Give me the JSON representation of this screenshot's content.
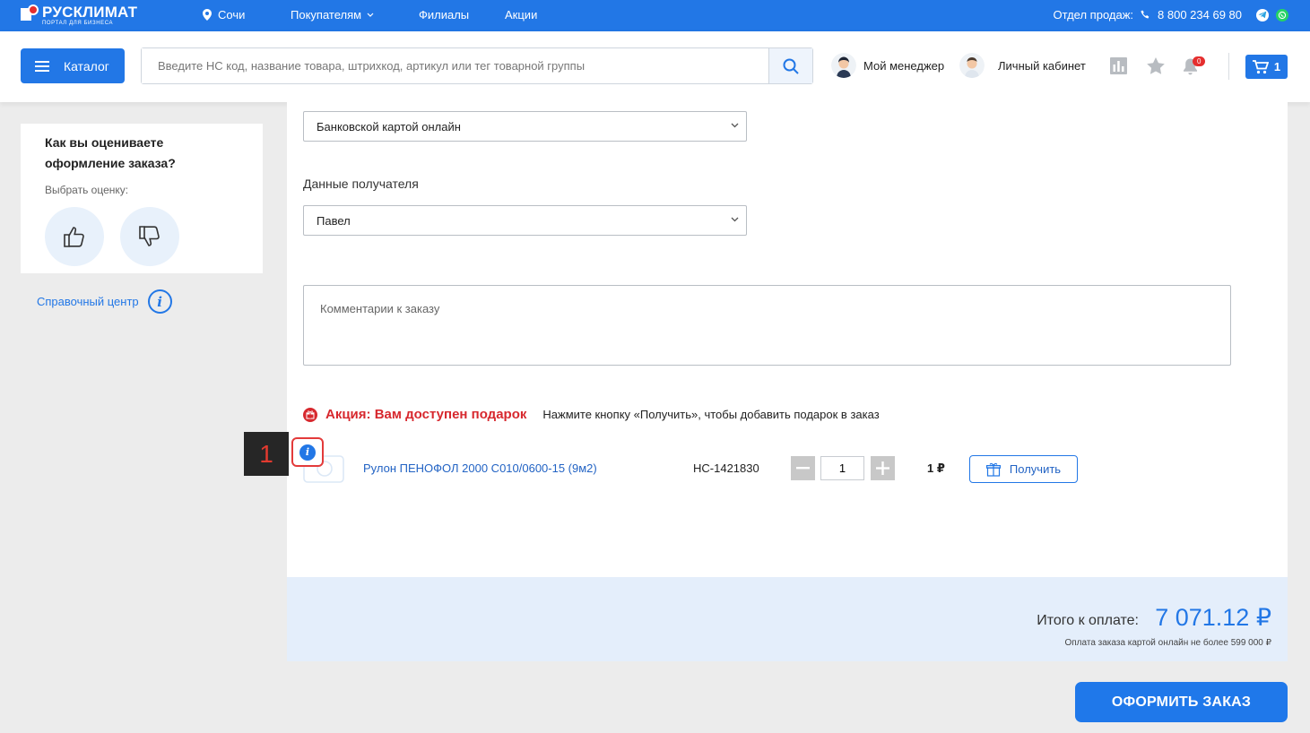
{
  "topbar": {
    "logo_title": "РУСКЛИМАТ",
    "logo_sub": "ПОРТАЛ ДЛЯ БИЗНЕСА",
    "city": "Сочи",
    "nav": [
      "Покупателям",
      "Филиалы",
      "Акции"
    ],
    "sales_label": "Отдел продаж:",
    "phone": "8 800 234 69 80",
    "colors": {
      "brand_blue": "#2277e6",
      "telegram": "#2aa3e0",
      "whatsapp": "#25d366"
    }
  },
  "header": {
    "catalog_label": "Каталог",
    "search_placeholder": "Введите НС код, название товара, штрихкод, артикул или тег товарной группы",
    "manager_label": "Мой менеджер",
    "account_label": "Личный кабинет",
    "notifications_count": "0",
    "cart_count": "1",
    "icons": [
      "menu-icon",
      "search-icon",
      "chart-icon",
      "star-icon",
      "bell-icon",
      "cart-icon"
    ]
  },
  "rating": {
    "title": "Как вы оцениваете оформление заказа?",
    "subtitle": "Выбрать оценку:"
  },
  "help": {
    "label": "Справочный центр"
  },
  "form": {
    "payment_method": "Банковской картой онлайн",
    "recipient_label": "Данные получателя",
    "recipient_value": "Павел",
    "comment_placeholder": "Комментарии к заказу"
  },
  "promo": {
    "title": "Акция: Вам доступен подарок",
    "note": "Нажмите кнопку «Получить», чтобы добавить подарок в заказ",
    "product_name": "Рулон ПЕНОФОЛ 2000 С010/0600-15 (9м2)",
    "product_code": "НС-1421830",
    "quantity": "1",
    "price": "1 ₽",
    "get_label": "Получить",
    "accent_color": "#d7282e"
  },
  "annotation": {
    "number": "1"
  },
  "total": {
    "label": "Итого к оплате:",
    "amount": "7 071.12 ₽",
    "note": "Оплата заказа картой онлайн не более 599 000 ₽"
  },
  "order_button": "ОФОРМИТЬ ЗАКАЗ"
}
